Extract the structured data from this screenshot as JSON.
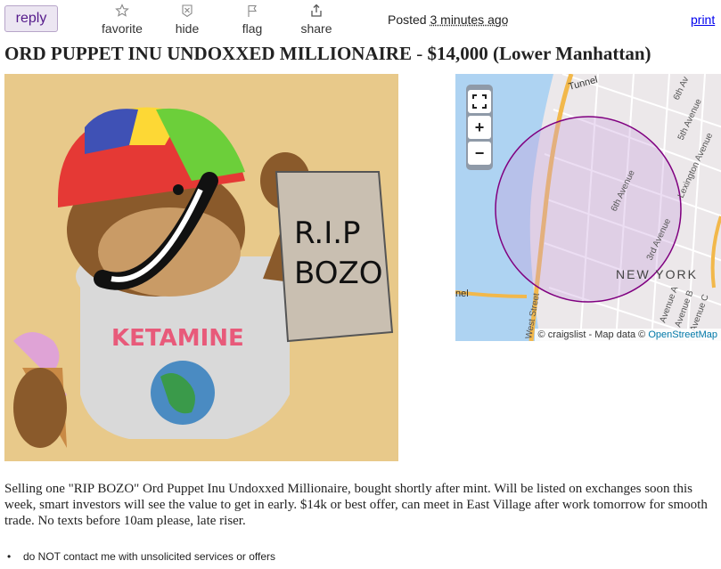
{
  "toolbar": {
    "reply_label": "reply",
    "favorite_label": "favorite",
    "hide_label": "hide",
    "flag_label": "flag",
    "share_label": "share",
    "posted_prefix": "Posted",
    "posted_time": "3 minutes ago",
    "print_label": "print",
    "icons": [
      "star-icon",
      "hide-icon",
      "flag-icon",
      "share-icon"
    ]
  },
  "listing": {
    "title": "ORD PUPPET INU UNDOXXED MILLIONAIRE",
    "separator": "-",
    "price": "$14,000",
    "location": "(Lower Manhattan)"
  },
  "image": {
    "sign_line1": "R.I.P",
    "sign_line2": "BOZO",
    "shirt_text": "KETAMINE"
  },
  "map": {
    "zoom_in": "+",
    "zoom_out": "−",
    "fullscreen_icon": "fullscreen-icon",
    "labels": {
      "tunnel": "Tunnel",
      "sixth_ave_top": "6th Av",
      "fifth_ave": "5th Avenue",
      "lexington": "Lexington Avenue",
      "sixth_ave": "6th Avenue",
      "third_ave": "3rd Avenue",
      "new_york": "NEW YORK",
      "west_street": "West Street",
      "avenue_a": "Avenue A",
      "avenue_b": "Avenue B",
      "avenue_c": "Avenue C",
      "tunnel_left": "nel"
    },
    "attribution_prefix": "© craigslist - Map data ©",
    "attribution_link": "OpenStreetMap"
  },
  "description": "Selling one \"RIP BOZO\" Ord Puppet Inu Undoxxed Millionaire, bought shortly after mint. Will be listed on exchanges soon this week, smart investors will see the value to get in early. $14k or best offer, can meet in East Village after work tomorrow for smooth trade. No texts before 10am please, late riser.",
  "notices": [
    "do NOT contact me with unsolicited services or offers"
  ],
  "colors": {
    "link": "#0000ee",
    "reply_bg": "#ece6f2",
    "reply_text": "#551a8b",
    "map_circle": "#800080"
  }
}
